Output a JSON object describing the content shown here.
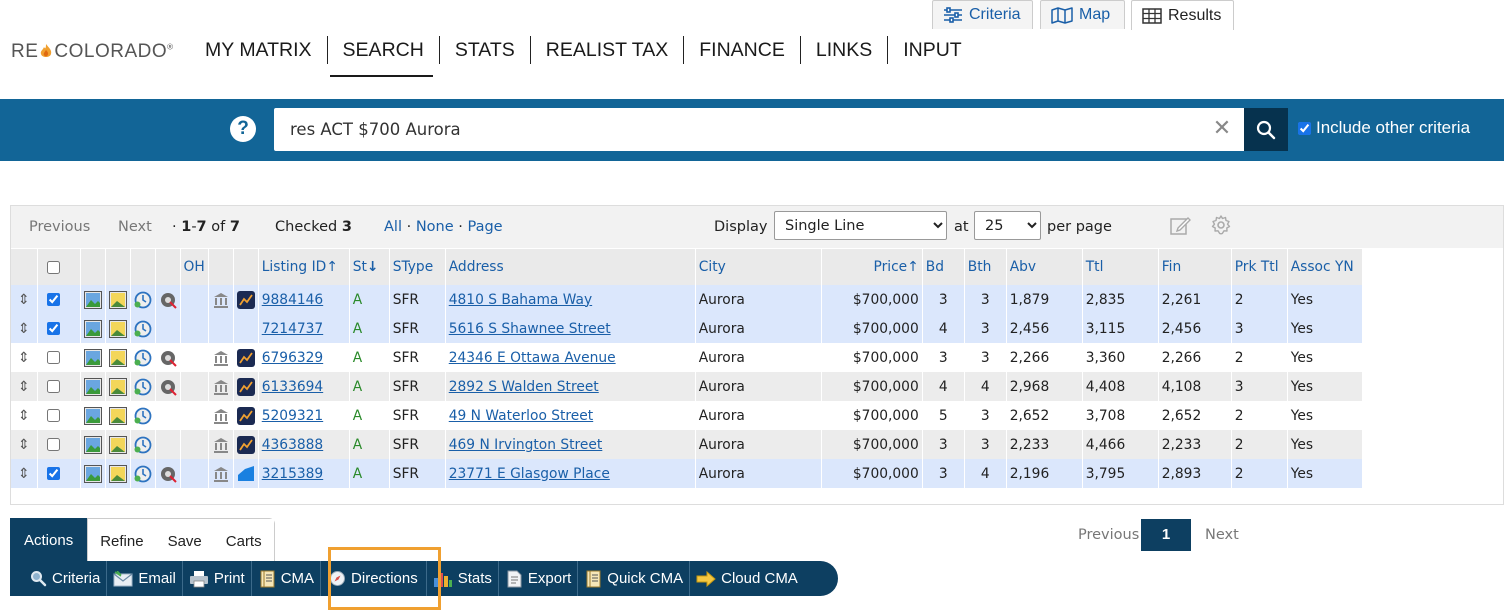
{
  "logo": {
    "text_left": "RE",
    "text_right": "COLORADO",
    "mark": "®"
  },
  "nav": {
    "items": [
      {
        "label": "MY MATRIX"
      },
      {
        "label": "SEARCH"
      },
      {
        "label": "STATS"
      },
      {
        "label": "REALIST TAX"
      },
      {
        "label": "FINANCE"
      },
      {
        "label": "LINKS"
      },
      {
        "label": "INPUT"
      }
    ],
    "active": "SEARCH"
  },
  "search": {
    "help": "?",
    "value": "res ACT $700 Aurora",
    "clear": "✕",
    "include_label": "Include other criteria",
    "include_checked": true
  },
  "view_tabs": [
    {
      "label": "Criteria",
      "icon": "sliders-icon"
    },
    {
      "label": "Map",
      "icon": "map-icon"
    },
    {
      "label": "Results",
      "icon": "grid-icon"
    }
  ],
  "toolbar": {
    "previous": "Previous",
    "next": "Next",
    "range_start": "1",
    "range_end": "7",
    "of": "of",
    "total": "7",
    "checked_label": "Checked",
    "checked_count": "3",
    "all": "All",
    "none": "None",
    "page": "Page",
    "display_label": "Display",
    "display_value": "Single Line",
    "at_label": "at",
    "per_page_value": "25",
    "per_page_label": "per page"
  },
  "columns": {
    "oh": "OH",
    "listing_id": "Listing ID",
    "st": "St",
    "stype": "SType",
    "address": "Address",
    "city": "City",
    "price": "Price",
    "bd": "Bd",
    "bth": "Bth",
    "abv": "Abv",
    "ttl": "Ttl",
    "fin": "Fin",
    "prk": "Prk Ttl",
    "assoc": "Assoc YN"
  },
  "rows": [
    {
      "id": "9884146",
      "st": "A",
      "stype": "SFR",
      "address": "4810 S Bahama Way",
      "city": "Aurora",
      "price": "$700,000",
      "bd": "3",
      "bth": "3",
      "abv": "1,879",
      "ttl": "2,835",
      "fin": "2,261",
      "prk": "2",
      "assoc": "Yes"
    },
    {
      "id": "7214737",
      "st": "A",
      "stype": "SFR",
      "address": "5616 S Shawnee Street",
      "city": "Aurora",
      "price": "$700,000",
      "bd": "4",
      "bth": "3",
      "abv": "2,456",
      "ttl": "3,115",
      "fin": "2,456",
      "prk": "3",
      "assoc": "Yes"
    },
    {
      "id": "6796329",
      "st": "A",
      "stype": "SFR",
      "address": "24346 E Ottawa Avenue",
      "city": "Aurora",
      "price": "$700,000",
      "bd": "3",
      "bth": "3",
      "abv": "2,266",
      "ttl": "3,360",
      "fin": "2,266",
      "prk": "2",
      "assoc": "Yes"
    },
    {
      "id": "6133694",
      "st": "A",
      "stype": "SFR",
      "address": "2892 S Walden Street",
      "city": "Aurora",
      "price": "$700,000",
      "bd": "4",
      "bth": "4",
      "abv": "2,968",
      "ttl": "4,408",
      "fin": "4,108",
      "prk": "3",
      "assoc": "Yes"
    },
    {
      "id": "5209321",
      "st": "A",
      "stype": "SFR",
      "address": "49 N Waterloo Street",
      "city": "Aurora",
      "price": "$700,000",
      "bd": "5",
      "bth": "3",
      "abv": "2,652",
      "ttl": "3,708",
      "fin": "2,652",
      "prk": "2",
      "assoc": "Yes"
    },
    {
      "id": "4363888",
      "st": "A",
      "stype": "SFR",
      "address": "469 N Irvington Street",
      "city": "Aurora",
      "price": "$700,000",
      "bd": "3",
      "bth": "3",
      "abv": "2,233",
      "ttl": "4,466",
      "fin": "2,233",
      "prk": "2",
      "assoc": "Yes"
    },
    {
      "id": "3215389",
      "st": "A",
      "stype": "SFR",
      "address": "23771 E Glasgow Place",
      "city": "Aurora",
      "price": "$700,000",
      "bd": "3",
      "bth": "4",
      "abv": "2,196",
      "ttl": "3,795",
      "fin": "2,893",
      "prk": "2",
      "assoc": "Yes"
    }
  ],
  "bottom_tabs": [
    {
      "label": "Actions"
    },
    {
      "label": "Refine"
    },
    {
      "label": "Save"
    },
    {
      "label": "Carts"
    }
  ],
  "actions": [
    {
      "label": "Criteria",
      "icon": "magnifier-icon"
    },
    {
      "label": "Email",
      "icon": "email-icon"
    },
    {
      "label": "Print",
      "icon": "printer-icon"
    },
    {
      "label": "CMA",
      "icon": "notebook-icon"
    },
    {
      "label": "Directions",
      "icon": "compass-icon"
    },
    {
      "label": "Stats",
      "icon": "bar-chart-icon"
    },
    {
      "label": "Export",
      "icon": "export-icon"
    },
    {
      "label": "Quick CMA",
      "icon": "notebook-icon"
    },
    {
      "label": "Cloud CMA",
      "icon": "arrow-right-icon"
    }
  ],
  "pager": {
    "previous": "Previous",
    "current": "1",
    "next": "Next"
  },
  "colors": {
    "brand_blue": "#126597",
    "dark_navy": "#0d3f61",
    "link": "#1a5fa8",
    "highlight": "#f0a030",
    "checked_row": "#dbe7fc"
  }
}
